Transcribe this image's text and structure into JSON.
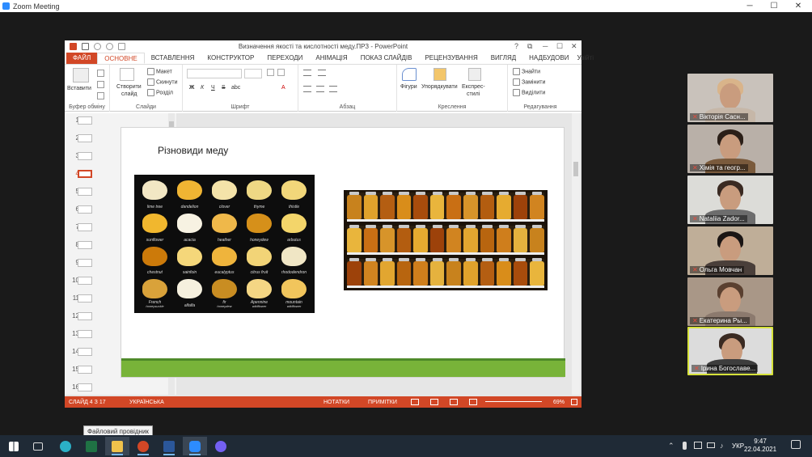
{
  "zoom": {
    "title": "Zoom Meeting",
    "controls": {
      "minimize": "─",
      "maximize": "☐",
      "close": "✕"
    }
  },
  "ppt": {
    "title": "Визначення якості та кислотності меду.ПРЗ - PowerPoint",
    "title_controls": {
      "help": "?",
      "restore": "⧉",
      "minimize": "─",
      "maximize": "☐",
      "close": "✕"
    },
    "tabs": [
      {
        "label": "ФАЙЛ"
      },
      {
        "label": "ОСНОВНЕ"
      },
      {
        "label": "ВСТАВЛЕННЯ"
      },
      {
        "label": "КОНСТРУКТОР"
      },
      {
        "label": "ПЕРЕХОДИ"
      },
      {
        "label": "АНІМАЦІЯ"
      },
      {
        "label": "ПОКАЗ СЛАЙДІВ"
      },
      {
        "label": "РЕЦЕНЗУВАННЯ"
      },
      {
        "label": "ВИГЛЯД"
      },
      {
        "label": "НАДБУДОВИ"
      },
      {
        "label": "Увійті"
      }
    ],
    "ribbon": {
      "paste": "Вставити",
      "clipboard": "Буфер обміну",
      "new_slide_1": "Створити",
      "new_slide_2": "слайд",
      "layout": "Макет",
      "reset": "Скинути",
      "section": "Розділ",
      "slides": "Слайди",
      "font": "Шрифт",
      "paragraph": "Абзац",
      "shapes": "Фігури",
      "arrange": "Упорядкувати",
      "quick_styles_1": "Експрес-",
      "quick_styles_2": "стилі",
      "drawing": "Креслення",
      "find": "Знайти",
      "replace": "Замінити",
      "select": "Виділити",
      "editing": "Редагування",
      "font_buttons": {
        "bold": "Ж",
        "italic": "К",
        "underline": "Ч",
        "strike": "S",
        "shadow": "abc",
        "font_color": "A"
      }
    },
    "thumbnails": [
      "1",
      "2",
      "3",
      "4",
      "5",
      "6",
      "7",
      "8",
      "9",
      "10",
      "11",
      "12",
      "13",
      "14",
      "15",
      "16"
    ],
    "slide": {
      "title": "Різновиди меду",
      "honey_labels": [
        {
          "name": "lime tree"
        },
        {
          "name": "dandelion"
        },
        {
          "name": "clover"
        },
        {
          "name": "thyme"
        },
        {
          "name": "thistle"
        },
        {
          "name": "sunflower"
        },
        {
          "name": "acacia"
        },
        {
          "name": "heather"
        },
        {
          "name": "honeydew"
        },
        {
          "name": "arbutus"
        },
        {
          "name": "chestnut"
        },
        {
          "name": "sainfoin"
        },
        {
          "name": "eucalyptus"
        },
        {
          "name": "citrus fruit"
        },
        {
          "name": "rhododendron"
        },
        {
          "name": "French",
          "sub": "honeysuckle"
        },
        {
          "name": "alfalfa"
        },
        {
          "name": "fir",
          "sub": "honeydew"
        },
        {
          "name": "Apennine",
          "sub": "wildflower"
        },
        {
          "name": "mountain",
          "sub": "wildflower"
        }
      ]
    },
    "status": {
      "slide": "СЛАЙД 4 З 17",
      "lang": "УКРАЇНСЬКА",
      "notes": "НОТАТКИ",
      "comments": "ПРИМІТКИ",
      "zoom": "69%"
    }
  },
  "participants": [
    {
      "name": "Вікторія Сасн...",
      "hair": "#d9b48a",
      "body": "#c6b7a8",
      "bg": "#c9c2bb"
    },
    {
      "name": "Хімія та геогр...",
      "hair": "#2b1f18",
      "body": "#7a5a3c",
      "bg": "#b9b0a8"
    },
    {
      "name": "Nataliia Zador...",
      "hair": "#3a2a22",
      "body": "#6d6d6d",
      "bg": "#dcdcd8"
    },
    {
      "name": "Ольга Мовчан",
      "hair": "#1a1514",
      "body": "#4a3f3a",
      "bg": "#bfae98"
    },
    {
      "name": "Екатерина Ры...",
      "hair": "#5a4030",
      "body": "#8c7a6e",
      "bg": "#a99787"
    },
    {
      "name": "Ірина Богославе...",
      "hair": "#3a2a22",
      "body": "#3d3d3d",
      "bg": "#dcdcdc"
    }
  ],
  "tooltip": "Файловий провідник",
  "taskbar": {
    "lang": "УКР",
    "time": "9:47",
    "date": "22.04.2021"
  },
  "colors": {
    "accent": "#d24726",
    "green_bar": "#78b339",
    "zoom_blue": "#2d8cff"
  }
}
